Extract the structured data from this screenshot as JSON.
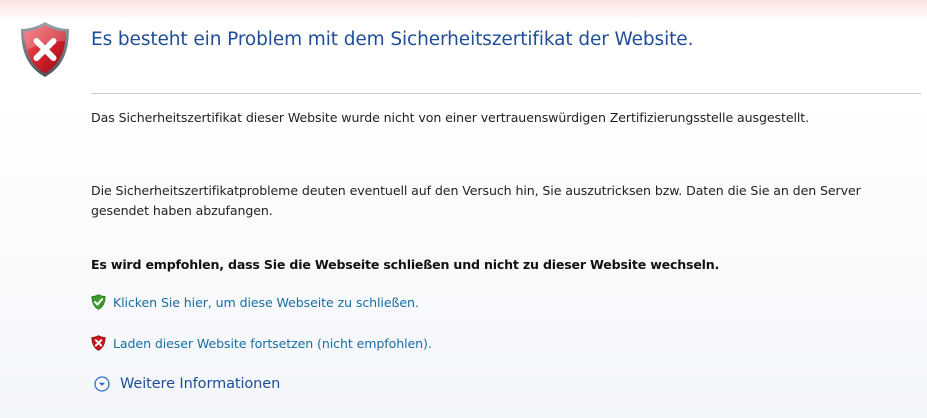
{
  "header": {
    "title": "Es besteht ein Problem mit dem Sicherheitszertifikat der Website."
  },
  "body": {
    "paragraph1": "Das Sicherheitszertifikat dieser Website wurde nicht von einer vertrauenswürdigen Zertifizierungsstelle ausgestellt.",
    "paragraph2": "Die Sicherheitszertifikatprobleme deuten eventuell auf den Versuch hin, Sie auszutricksen bzw. Daten die Sie an den Server gesendet haben abzufangen.",
    "recommendation": "Es wird empfohlen, dass Sie die Webseite schließen und nicht zu dieser Website wechseln."
  },
  "actions": {
    "close_label": "Klicken Sie hier, um diese Webseite zu schließen.",
    "continue_label": "Laden dieser Website fortsetzen (nicht empfohlen).",
    "more_info_label": "Weitere Informationen"
  },
  "icons": {
    "main": "shield-error-icon",
    "close": "shield-check-icon",
    "continue": "shield-error-small-icon",
    "more": "chevron-down-circle-icon"
  },
  "colors": {
    "title": "#1f4e98",
    "link": "#1a6ea3",
    "error_red": "#c8161d",
    "safe_green": "#3a9a2c"
  }
}
